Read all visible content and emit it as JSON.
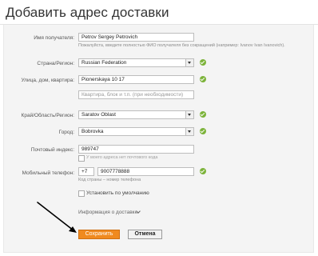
{
  "page": {
    "title": "Добавить адрес доставки"
  },
  "form": {
    "recipient": {
      "label": "Имя получателя:",
      "value": "Petrov Sergey Petrovich",
      "hint": "Пожалуйста, введите полностью ФИО получателя без сокращений (например: Ivanov Ivan Ivanovich)."
    },
    "country": {
      "label": "Страна/Регион:",
      "value": "Russian Federation"
    },
    "street": {
      "label": "Улица, дом, квартира:",
      "value": "Pionerskaya 10 17",
      "placeholder": "Квартира, блок и т.п. (при необходимости)"
    },
    "region": {
      "label": "Край/Область/Регион:",
      "value": "Saratov Oblast"
    },
    "city": {
      "label": "Город:",
      "value": "Bobrovka"
    },
    "postal": {
      "label": "Почтовый индекс:",
      "value": "989747",
      "no_postal_label": "У моего адреса нет почтового кода"
    },
    "phone": {
      "label": "Мобильный телефон:",
      "country_code": "+7",
      "number": "9007778888",
      "hint": "Код страны – номер телефона"
    },
    "default_checkbox_label": "Установить по умолчанию",
    "delivery_info_label": "Информация о доставке",
    "save_label": "Сохранить",
    "cancel_label": "Отмена"
  },
  "colors": {
    "accent": "#f08a1f",
    "valid": "#7cb33a"
  },
  "icons": [
    "check-circle-icon",
    "chevron-down-icon",
    "pointer-arrow"
  ]
}
